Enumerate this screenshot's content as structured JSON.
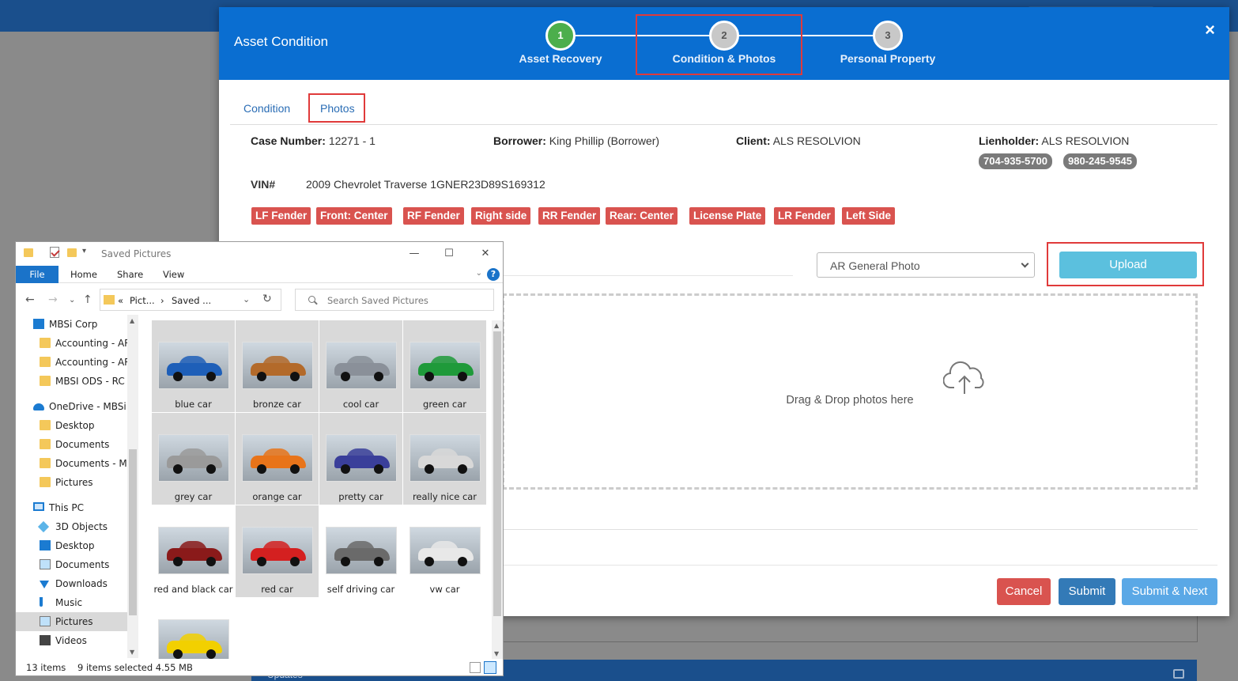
{
  "modal": {
    "title": "Asset Condition",
    "close_label": "×",
    "steps": [
      {
        "number": "1",
        "label": "Asset Recovery",
        "status": "complete"
      },
      {
        "number": "2",
        "label": "Condition & Photos",
        "status": "current"
      },
      {
        "number": "3",
        "label": "Personal Property",
        "status": "pending"
      }
    ],
    "tabs": [
      {
        "label": "Condition"
      },
      {
        "label": "Photos"
      }
    ],
    "case_number_label": "Case Number:",
    "case_number": "12271 - 1",
    "borrower_label": "Borrower:",
    "borrower": "King Phillip (Borrower)",
    "client_label": "Client:",
    "client": "ALS RESOLVION",
    "lienholder_label": "Lienholder:",
    "lienholder": "ALS RESOLVION",
    "phones": [
      "704-935-5700",
      "980-245-9545"
    ],
    "vin_label": "VIN#",
    "vin_value": "2009 Chevrolet Traverse 1GNER23D89S169312",
    "photo_tags": [
      "LF Fender",
      "Front: Center",
      "RF Fender",
      "Right side",
      "RR Fender",
      "Rear: Center",
      "License Plate",
      "LR Fender",
      "Left Side"
    ],
    "photo_type_selected": "AR General Photo",
    "upload_label": "Upload",
    "drop_text": "Drag & Drop photos here",
    "cancel_label": "Cancel",
    "submit_label": "Submit",
    "submit_next_label": "Submit & Next",
    "colors": {
      "header": "#0a6ed1",
      "tag": "#d9534f",
      "upload": "#5bc0de",
      "cancel": "#d9534f",
      "submit": "#337ab7",
      "submit_next": "#5aa8e6",
      "step_done": "#4cae4c",
      "highlight": "#e03a3a"
    }
  },
  "background": {
    "bottom_bar_text": "Updates"
  },
  "explorer": {
    "title": "Saved Pictures",
    "ribbon_tabs": [
      "File",
      "Home",
      "Share",
      "View"
    ],
    "address_crumbs": [
      "«",
      "Pict...",
      "›",
      "Saved ..."
    ],
    "search_placeholder": "Search Saved Pictures",
    "nav_items": [
      {
        "label": "MBSi Corp",
        "icon": "building-icon"
      },
      {
        "label": "Accounting - AR",
        "icon": "folder-icon"
      },
      {
        "label": "Accounting - AR",
        "icon": "folder-icon"
      },
      {
        "label": "MBSI ODS - RC E",
        "icon": "folder-icon"
      },
      {
        "label": "OneDrive - MBSi C",
        "icon": "cloud-icon"
      },
      {
        "label": "Desktop",
        "icon": "folder-icon"
      },
      {
        "label": "Documents",
        "icon": "folder-icon"
      },
      {
        "label": "Documents - Ma",
        "icon": "folder-sync-icon"
      },
      {
        "label": "Pictures",
        "icon": "folder-icon"
      },
      {
        "label": "This PC",
        "icon": "pc-icon"
      },
      {
        "label": "3D Objects",
        "icon": "cube-icon"
      },
      {
        "label": "Desktop",
        "icon": "desktop-icon"
      },
      {
        "label": "Documents",
        "icon": "documents-icon"
      },
      {
        "label": "Downloads",
        "icon": "download-icon"
      },
      {
        "label": "Music",
        "icon": "music-icon"
      },
      {
        "label": "Pictures",
        "icon": "pictures-icon"
      },
      {
        "label": "Videos",
        "icon": "video-icon"
      }
    ],
    "files": [
      {
        "name": "blue car",
        "color": "#1e5fb8",
        "selected": true
      },
      {
        "name": "bronze car",
        "color": "#b36a2a",
        "selected": true
      },
      {
        "name": "cool car",
        "color": "#8a9099",
        "selected": true
      },
      {
        "name": "green car",
        "color": "#1f9a3a",
        "selected": true
      },
      {
        "name": "grey car",
        "color": "#9a9a9a",
        "selected": true
      },
      {
        "name": "orange car",
        "color": "#e8741a",
        "selected": true
      },
      {
        "name": "pretty car",
        "color": "#3a3f9a",
        "selected": true
      },
      {
        "name": "really nice car",
        "color": "#d8d8d8",
        "selected": true
      },
      {
        "name": "red and black car",
        "color": "#8a1a1a",
        "selected": false
      },
      {
        "name": "red car",
        "color": "#d42020",
        "selected": true
      },
      {
        "name": "self driving car",
        "color": "#6a6a6a",
        "selected": false
      },
      {
        "name": "vw car",
        "color": "#e8e8e8",
        "selected": false
      },
      {
        "name": "",
        "color": "#f2d000",
        "selected": false
      }
    ],
    "item_count": "13 items",
    "selection_info": "9 items selected  4.55 MB"
  }
}
